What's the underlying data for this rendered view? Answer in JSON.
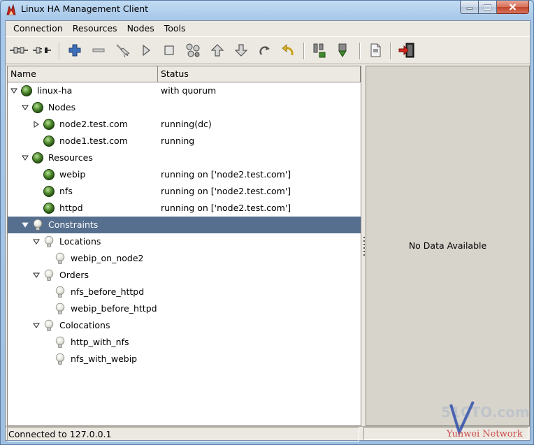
{
  "window": {
    "title": "Linux HA Management Client",
    "icon": "linux-ha-icon",
    "controls": [
      "minimize-icon",
      "maximize-icon",
      "close-icon"
    ]
  },
  "menu": [
    {
      "label": "Connection"
    },
    {
      "label": "Resources"
    },
    {
      "label": "Nodes"
    },
    {
      "label": "Tools"
    }
  ],
  "toolbar": {
    "buttons": [
      "connect-icon",
      "disconnect-icon",
      "add-icon",
      "remove-icon",
      "cleanup-icon",
      "start-icon",
      "stop-icon",
      "default-icon",
      "move-up-icon",
      "move-down-icon",
      "refresh-icon",
      "undo-icon",
      "standby-icon",
      "active-icon",
      "view-log-icon",
      "exit-icon"
    ]
  },
  "tree": {
    "columns": {
      "name": "Name",
      "status": "Status"
    },
    "rows": [
      {
        "label": "linux-ha",
        "status": "with quorum",
        "icon": "green-orb-icon",
        "toggle": "expanded"
      },
      {
        "label": "Nodes",
        "status": "",
        "icon": "green-orb-icon",
        "toggle": "expanded"
      },
      {
        "label": "node2.test.com",
        "status": "running(dc)",
        "icon": "green-orb-icon",
        "toggle": "collapsed"
      },
      {
        "label": "node1.test.com",
        "status": "running",
        "icon": "green-orb-icon",
        "toggle": "none"
      },
      {
        "label": "Resources",
        "status": "",
        "icon": "green-orb-icon",
        "toggle": "expanded"
      },
      {
        "label": "webip",
        "status": "running on ['node2.test.com']",
        "icon": "green-orb-icon",
        "toggle": "none"
      },
      {
        "label": "nfs",
        "status": "running on ['node2.test.com']",
        "icon": "green-orb-icon",
        "toggle": "none"
      },
      {
        "label": "httpd",
        "status": "running on ['node2.test.com']",
        "icon": "green-orb-icon",
        "toggle": "none"
      },
      {
        "label": "Constraints",
        "status": "",
        "icon": "lightbulb-icon",
        "toggle": "expanded",
        "selected": true
      },
      {
        "label": "Locations",
        "status": "",
        "icon": "lightbulb-icon",
        "toggle": "expanded"
      },
      {
        "label": "webip_on_node2",
        "status": "",
        "icon": "lightbulb-icon",
        "toggle": "none"
      },
      {
        "label": "Orders",
        "status": "",
        "icon": "lightbulb-icon",
        "toggle": "expanded"
      },
      {
        "label": "nfs_before_httpd",
        "status": "",
        "icon": "lightbulb-icon",
        "toggle": "none"
      },
      {
        "label": "webip_before_httpd",
        "status": "",
        "icon": "lightbulb-icon",
        "toggle": "none"
      },
      {
        "label": "Colocations",
        "status": "",
        "icon": "lightbulb-icon",
        "toggle": "expanded"
      },
      {
        "label": "http_with_nfs",
        "status": "",
        "icon": "lightbulb-icon",
        "toggle": "none"
      },
      {
        "label": "nfs_with_webip",
        "status": "",
        "icon": "lightbulb-icon",
        "toggle": "none"
      }
    ]
  },
  "detail": {
    "empty_message": "No Data Available"
  },
  "statusbar": {
    "text": "Connected to 127.0.0.1"
  },
  "watermark": {
    "line1": "51CTO.com",
    "line2": "Yunwei Network"
  },
  "colors": {
    "selection": "#566f8e",
    "orb": "#4f8a2c",
    "window_frame": "#a9c9ea"
  }
}
